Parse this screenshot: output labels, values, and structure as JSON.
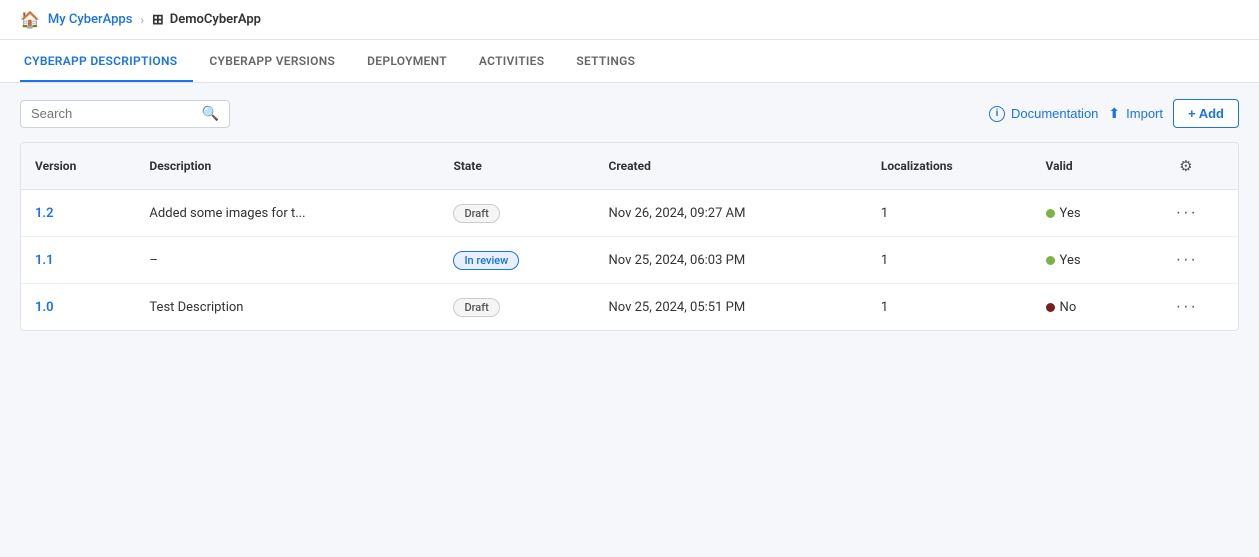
{
  "breadcrumb": {
    "home_label": "My CyberApps",
    "separator": "›",
    "current_label": "DemoCyberApp"
  },
  "tabs": [
    {
      "id": "descriptions",
      "label": "CYBERAPP DESCRIPTIONS",
      "active": true
    },
    {
      "id": "versions",
      "label": "CYBERAPP VERSIONS",
      "active": false
    },
    {
      "id": "deployment",
      "label": "DEPLOYMENT",
      "active": false
    },
    {
      "id": "activities",
      "label": "ACTIVITIES",
      "active": false
    },
    {
      "id": "settings",
      "label": "SETTINGS",
      "active": false
    }
  ],
  "toolbar": {
    "search_placeholder": "Search",
    "docs_label": "Documentation",
    "import_label": "Import",
    "add_label": "+ Add"
  },
  "table": {
    "columns": [
      {
        "id": "version",
        "label": "Version"
      },
      {
        "id": "description",
        "label": "Description"
      },
      {
        "id": "state",
        "label": "State"
      },
      {
        "id": "created",
        "label": "Created"
      },
      {
        "id": "localizations",
        "label": "Localizations"
      },
      {
        "id": "valid",
        "label": "Valid"
      },
      {
        "id": "actions",
        "label": ""
      }
    ],
    "rows": [
      {
        "version": "1.2",
        "description": "Added some images for t...",
        "state": "Draft",
        "state_type": "draft",
        "created": "Nov 26, 2024, 09:27 AM",
        "localizations": "1",
        "valid": "Yes",
        "valid_status": "green"
      },
      {
        "version": "1.1",
        "description": "–",
        "state": "In review",
        "state_type": "in-review",
        "created": "Nov 25, 2024, 06:03 PM",
        "localizations": "1",
        "valid": "Yes",
        "valid_status": "green"
      },
      {
        "version": "1.0",
        "description": "Test Description",
        "state": "Draft",
        "state_type": "draft",
        "created": "Nov 25, 2024, 05:51 PM",
        "localizations": "1",
        "valid": "No",
        "valid_status": "dark-red"
      }
    ]
  }
}
